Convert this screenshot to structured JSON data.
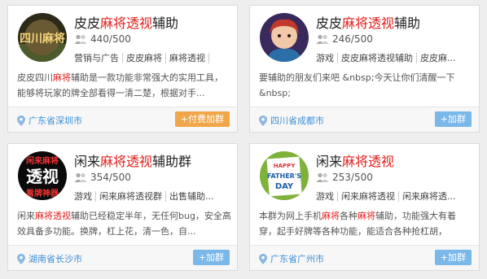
{
  "cards": [
    {
      "title_pre": "皮皮",
      "title_hl": "麻将透视",
      "title_post": "辅助",
      "members": "440/500",
      "tags": [
        "营销与广告",
        "皮皮麻将",
        "麻将透视",
        ""
      ],
      "desc_pre": "皮皮四川",
      "desc_hl": "麻将",
      "desc_post": "辅助是一款功能非常强大的实用工具，能够将玩家的牌全部看得一清二楚，根据对手...",
      "location": "广东省深圳市",
      "button": "+付费加群",
      "avatar_text": "四川麻将"
    },
    {
      "title_pre": "皮皮",
      "title_hl": "麻将透视",
      "title_post": "辅助",
      "members": "246/500",
      "tags": [
        "游戏",
        "皮皮麻将透视辅助",
        "皮皮麻..."
      ],
      "desc": "要辅助的朋友们来吧 &nbsp;今天让你们清醒一下 &nbsp;",
      "location": "四川省成都市",
      "button": "+加群"
    },
    {
      "title_pre": "闲来",
      "title_hl": "麻将透视",
      "title_post": "辅助群",
      "members": "354/500",
      "tags": [
        "游戏",
        "闲来麻将透视群",
        "出售辅助..."
      ],
      "desc_pre": "闲来",
      "desc_hl": "麻将透视",
      "desc_post": "辅助已经稳定半年，无任何bug，安全高效具备多功能。换牌，杠上花，清一色，自...",
      "location": "湖南省长沙市",
      "button": "+加群",
      "avatar_line1": "闲来麻将",
      "avatar_line2": "透视",
      "avatar_line3": "看牌神器"
    },
    {
      "title_pre": "闲来",
      "title_hl": "麻将透视",
      "title_post": "",
      "members": "253/500",
      "tags": [
        "游戏",
        "闲来麻将透视",
        "闲来麻将透..."
      ],
      "desc_pre": "本群为网上手机",
      "desc_hl1": "麻将",
      "desc_mid": "各种",
      "desc_hl2": "麻将",
      "desc_post": "辅助，功能强大有着穿，起手好牌等各种功能，能适合各种抢杠胡，",
      "location": "广东省广州市",
      "button": "+加群",
      "avatar_line1": "HAPPY",
      "avatar_line2": "FATHER'S",
      "avatar_line3": "DAY"
    }
  ],
  "colors": {
    "highlight": "#e2201c",
    "location": "#3b8fd6",
    "join_button": "#7ab8ea",
    "paid_button": "#f0a649"
  }
}
